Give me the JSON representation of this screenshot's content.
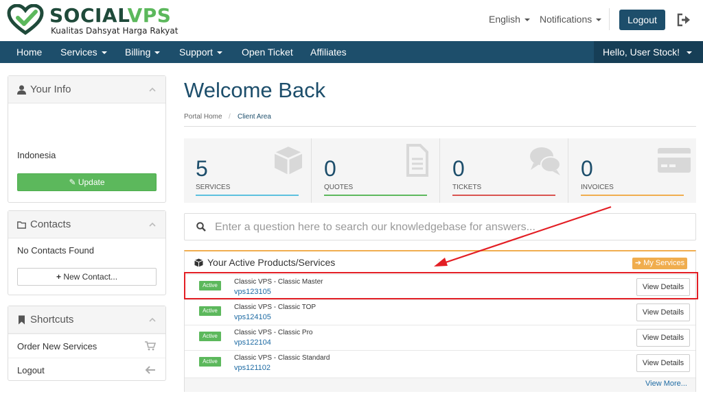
{
  "header": {
    "brand_name_a": "SOCIAL",
    "brand_name_b": "VPS",
    "tagline": "Kualitas Dahsyat Harga Rakyat",
    "language": "English",
    "notifications": "Notifications",
    "logout": "Logout",
    "exit_icon": "sign-out-icon"
  },
  "nav": {
    "items": [
      "Home",
      "Services",
      "Billing",
      "Support",
      "Open Ticket",
      "Affiliates"
    ],
    "user": "Hello, User Stock!"
  },
  "sidebar": {
    "your_info": {
      "title": "Your Info",
      "country": "Indonesia",
      "update_button": "Update"
    },
    "contacts": {
      "title": "Contacts",
      "empty_text": "No Contacts Found",
      "new_button": "New Contact..."
    },
    "shortcuts": {
      "title": "Shortcuts",
      "items": [
        "Order New Services",
        "Logout"
      ]
    }
  },
  "main": {
    "title": "Welcome Back",
    "breadcrumb": {
      "home": "Portal Home",
      "separator": "/",
      "current": "Client Area"
    },
    "stats": [
      {
        "count": "5",
        "label": "SERVICES",
        "color": "#5bc0de",
        "icon": "cube-icon"
      },
      {
        "count": "0",
        "label": "QUOTES",
        "color": "#5cb85c",
        "icon": "file-icon"
      },
      {
        "count": "0",
        "label": "TICKETS",
        "color": "#d9534f",
        "icon": "comments-icon"
      },
      {
        "count": "0",
        "label": "INVOICES",
        "color": "#f0ad4e",
        "icon": "credit-card-icon"
      }
    ],
    "kb_search_placeholder": "Enter a question here to search our knowledgebase for answers...",
    "products": {
      "title": "Your Active Products/Services",
      "my_services_button": "My Services",
      "status_label": "Active",
      "view_details_label": "View Details",
      "rows": [
        {
          "name": "Classic VPS - Classic Master",
          "domain": "vps123105",
          "highlighted": true
        },
        {
          "name": "Classic VPS - Classic TOP",
          "domain": "vps124105",
          "highlighted": false
        },
        {
          "name": "Classic VPS - Classic Pro",
          "domain": "vps122104",
          "highlighted": false
        },
        {
          "name": "Classic VPS - Classic Standard",
          "domain": "vps121102",
          "highlighted": false
        }
      ],
      "view_more": "View More..."
    }
  },
  "colors": {
    "primary": "#1d4e6b",
    "brand_green": "#5cb85c",
    "annotation_red": "#e31e24",
    "accent_orange": "#f0ad4e"
  }
}
